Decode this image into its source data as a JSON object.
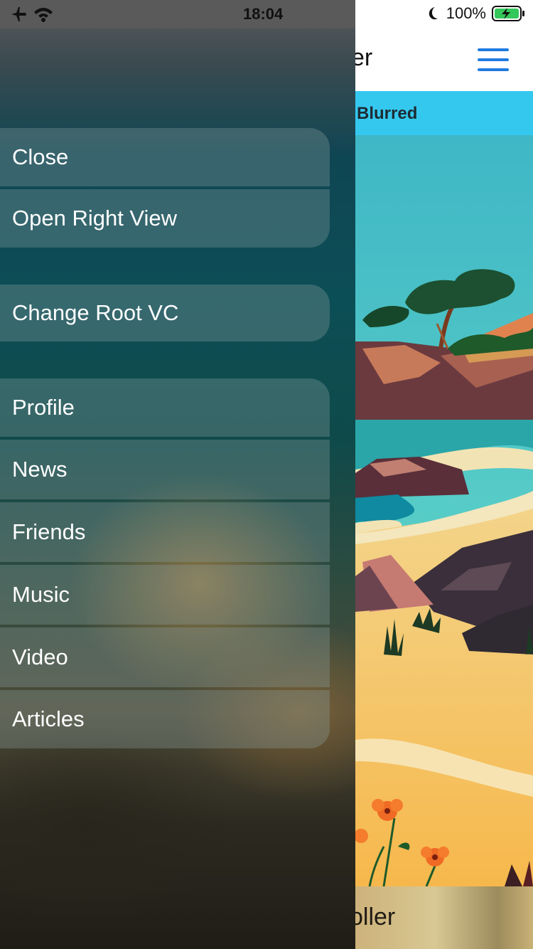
{
  "status_bar": {
    "time": "18:04",
    "battery_percent": "100%",
    "icons": [
      "airplane-icon",
      "wifi-icon",
      "moon-icon",
      "battery-charging-icon"
    ]
  },
  "main": {
    "nav_title": "oller",
    "banner_text": "e Blurred",
    "bottom_text": "oller",
    "menu_icon": "hamburger-icon",
    "accent": "#1f7ae0",
    "banner_color": "#35c8ef"
  },
  "drawer": {
    "group1": [
      {
        "label": "Close"
      },
      {
        "label": "Open Right View"
      }
    ],
    "group2": [
      {
        "label": "Change Root VC"
      }
    ],
    "group3": [
      {
        "label": "Profile"
      },
      {
        "label": "News"
      },
      {
        "label": "Friends"
      },
      {
        "label": "Music"
      },
      {
        "label": "Video"
      },
      {
        "label": "Articles"
      }
    ]
  }
}
